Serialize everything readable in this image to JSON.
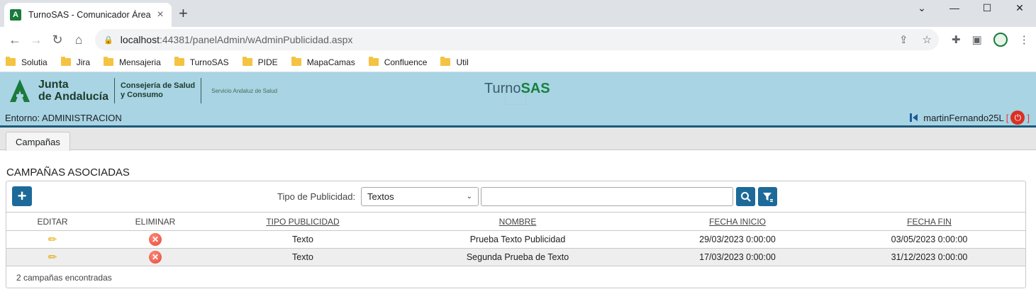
{
  "browser": {
    "tab_title": "TurnoSAS - Comunicador Área",
    "favicon_letter": "A",
    "url_host": "localhost",
    "url_path": ":44381/panelAdmin/wAdminPublicidad.aspx",
    "bookmarks": [
      "Solutia",
      "Jira",
      "Mensajeria",
      "TurnoSAS",
      "PIDE",
      "MapaCamas",
      "Confluence",
      "Util"
    ]
  },
  "header": {
    "logo_line1": "Junta",
    "logo_line2": "de Andalucía",
    "consejeria_line1": "Consejería de Salud",
    "consejeria_line2": "y Consumo",
    "sas": "Servicio Andaluz de Salud",
    "brand_light": "Turno",
    "brand_bold": "SAS",
    "entorno": "Entorno: ADMINISTRACION",
    "user": "martinFernando25L",
    "bracket_open": "[",
    "bracket_close": "]"
  },
  "tabs": {
    "campanas": "Campañas"
  },
  "section_title": "CAMPAÑAS ASOCIADAS",
  "filter": {
    "add_label": "+",
    "label": "Tipo de Publicidad:",
    "selected": "Textos",
    "search_value": ""
  },
  "table": {
    "headers": [
      "EDITAR",
      "ELIMINAR",
      "TIPO PUBLICIDAD",
      "NOMBRE",
      "FECHA INICIO",
      "FECHA FIN"
    ],
    "rows": [
      [
        "Texto",
        "Prueba Texto Publicidad",
        "29/03/2023 0:00:00",
        "03/05/2023 0:00:00"
      ],
      [
        "Texto",
        "Segunda Prueba de Texto",
        "17/03/2023 0:00:00",
        "31/12/2023 0:00:00"
      ]
    ]
  },
  "footer": {
    "count": "2 campañas encontradas"
  },
  "colors": {
    "header_bg": "#a8d4e4",
    "accent": "#1d6a9a",
    "brand_green": "#17803d"
  }
}
